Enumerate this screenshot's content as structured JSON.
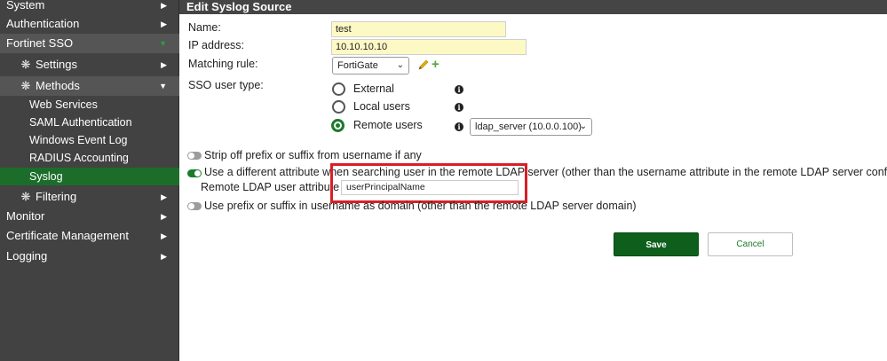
{
  "sidebar": {
    "items": [
      {
        "label": "System"
      },
      {
        "label": "Authentication"
      },
      {
        "label": "Fortinet SSO"
      },
      {
        "label": "Settings"
      },
      {
        "label": "Methods"
      },
      {
        "label": "Web Services"
      },
      {
        "label": "SAML Authentication"
      },
      {
        "label": "Windows Event Log"
      },
      {
        "label": "RADIUS Accounting"
      },
      {
        "label": "Syslog"
      },
      {
        "label": "Filtering"
      },
      {
        "label": "Monitor"
      },
      {
        "label": "Certificate Management"
      },
      {
        "label": "Logging"
      }
    ]
  },
  "page": {
    "title": "Edit Syslog Source"
  },
  "form": {
    "name_label": "Name:",
    "name_value": "test",
    "ip_label": "IP address:",
    "ip_value": "10.10.10.10",
    "matching_rule_label": "Matching rule:",
    "matching_rule_value": "FortiGate",
    "sso_user_type_label": "SSO user type:",
    "sso_options": [
      {
        "label": "External",
        "selected": false
      },
      {
        "label": "Local users",
        "selected": false
      },
      {
        "label": "Remote users",
        "selected": true
      }
    ],
    "ldap_server_value": "ldap_server (10.0.0.100)",
    "strip_prefix_label": "Strip off prefix or suffix from username if any",
    "strip_prefix_enabled": false,
    "diff_attr_label": "Use a different attribute when searching user in the remote LDAP server (other than the username attribute in the remote LDAP server config)",
    "diff_attr_enabled": true,
    "remote_ldap_attr_label": "Remote LDAP user attribute",
    "remote_ldap_attr_value": "userPrincipalName",
    "prefix_domain_label": "Use prefix or suffix in username as domain (other than the remote LDAP server domain)",
    "prefix_domain_enabled": false
  },
  "buttons": {
    "save": "Save",
    "cancel": "Cancel"
  },
  "colors": {
    "accent": "#1b7a2b",
    "sidebar": "#424242",
    "highlight": "#d81f26",
    "field": "#fdf9c5"
  }
}
